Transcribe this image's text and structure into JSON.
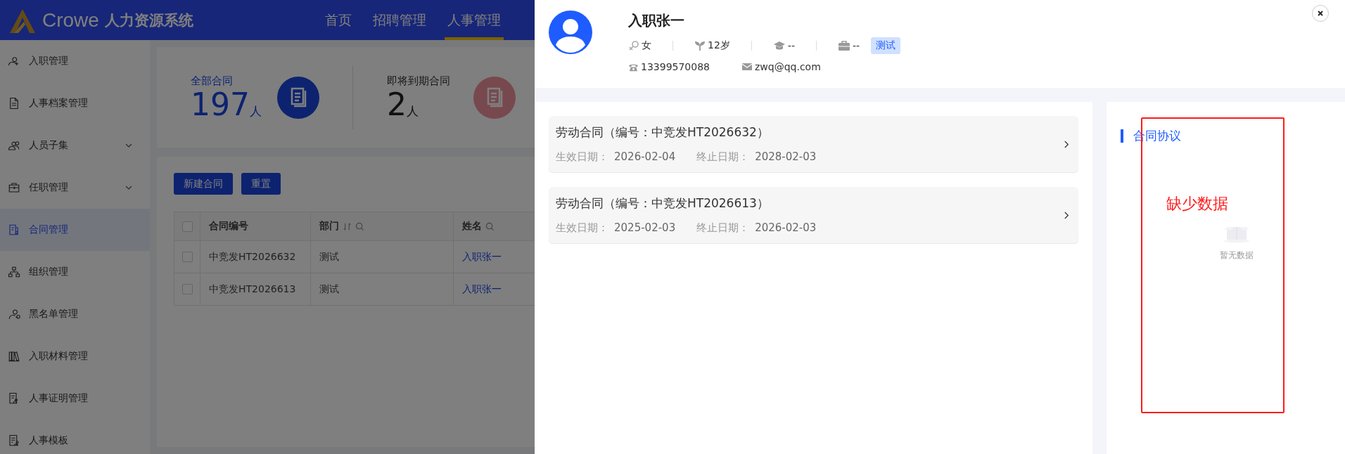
{
  "header": {
    "logo_text": "Crowe",
    "system_name": "人力资源系统",
    "nav": [
      {
        "label": "首页",
        "selected": false
      },
      {
        "label": "招聘管理",
        "selected": false
      },
      {
        "label": "人事管理",
        "selected": true
      }
    ]
  },
  "sidebar": {
    "items": [
      {
        "label": "入职管理",
        "expandable": false,
        "selected": false
      },
      {
        "label": "人事档案管理",
        "expandable": false,
        "selected": false
      },
      {
        "label": "人员子集",
        "expandable": true,
        "selected": false
      },
      {
        "label": "任职管理",
        "expandable": true,
        "selected": false
      },
      {
        "label": "合同管理",
        "expandable": false,
        "selected": true
      },
      {
        "label": "组织管理",
        "expandable": false,
        "selected": false
      },
      {
        "label": "黑名单管理",
        "expandable": false,
        "selected": false
      },
      {
        "label": "入职材料管理",
        "expandable": false,
        "selected": false
      },
      {
        "label": "人事证明管理",
        "expandable": false,
        "selected": false
      },
      {
        "label": "人事模板",
        "expandable": false,
        "selected": false
      }
    ]
  },
  "stats": [
    {
      "label": "全部合同",
      "value": "197",
      "unit": "人",
      "highlighted": true
    },
    {
      "label": "即将到期合同",
      "value": "2",
      "unit": "人",
      "highlighted": false
    }
  ],
  "toolbar": {
    "buttons": [
      "新建合同",
      "重置"
    ]
  },
  "table": {
    "header_checked": false,
    "columns": [
      {
        "label": "合同编号",
        "sortable": false,
        "searchable": false
      },
      {
        "label": "部门",
        "sortable": true,
        "searchable": true
      },
      {
        "label": "姓名",
        "sortable": false,
        "searchable": true
      }
    ],
    "rows": [
      {
        "checked": false,
        "cells": [
          "中竞发HT2026632",
          "测试",
          "入职张一"
        ]
      },
      {
        "checked": false,
        "cells": [
          "中竞发HT2026613",
          "测试",
          "入职张一"
        ]
      }
    ]
  },
  "drawer": {
    "name": "入职张一",
    "gender": "女",
    "age": "12岁",
    "education": "--",
    "position": "--",
    "tag": "测试",
    "phone": "13399570088",
    "email": "zwq@qq.com",
    "contracts": [
      {
        "title": "劳动合同（编号：中竞发HT2026632）",
        "start_label": "生效日期：",
        "start": "2026-02-04",
        "end_label": "终止日期：",
        "end": "2028-02-03"
      },
      {
        "title": "劳动合同（编号：中竞发HT2026613）",
        "start_label": "生效日期：",
        "start": "2025-02-03",
        "end_label": "终止日期：",
        "end": "2026-02-03"
      }
    ],
    "side_title": "合同协议",
    "empty_text": "暂无数据",
    "annotation": "缺少数据"
  }
}
